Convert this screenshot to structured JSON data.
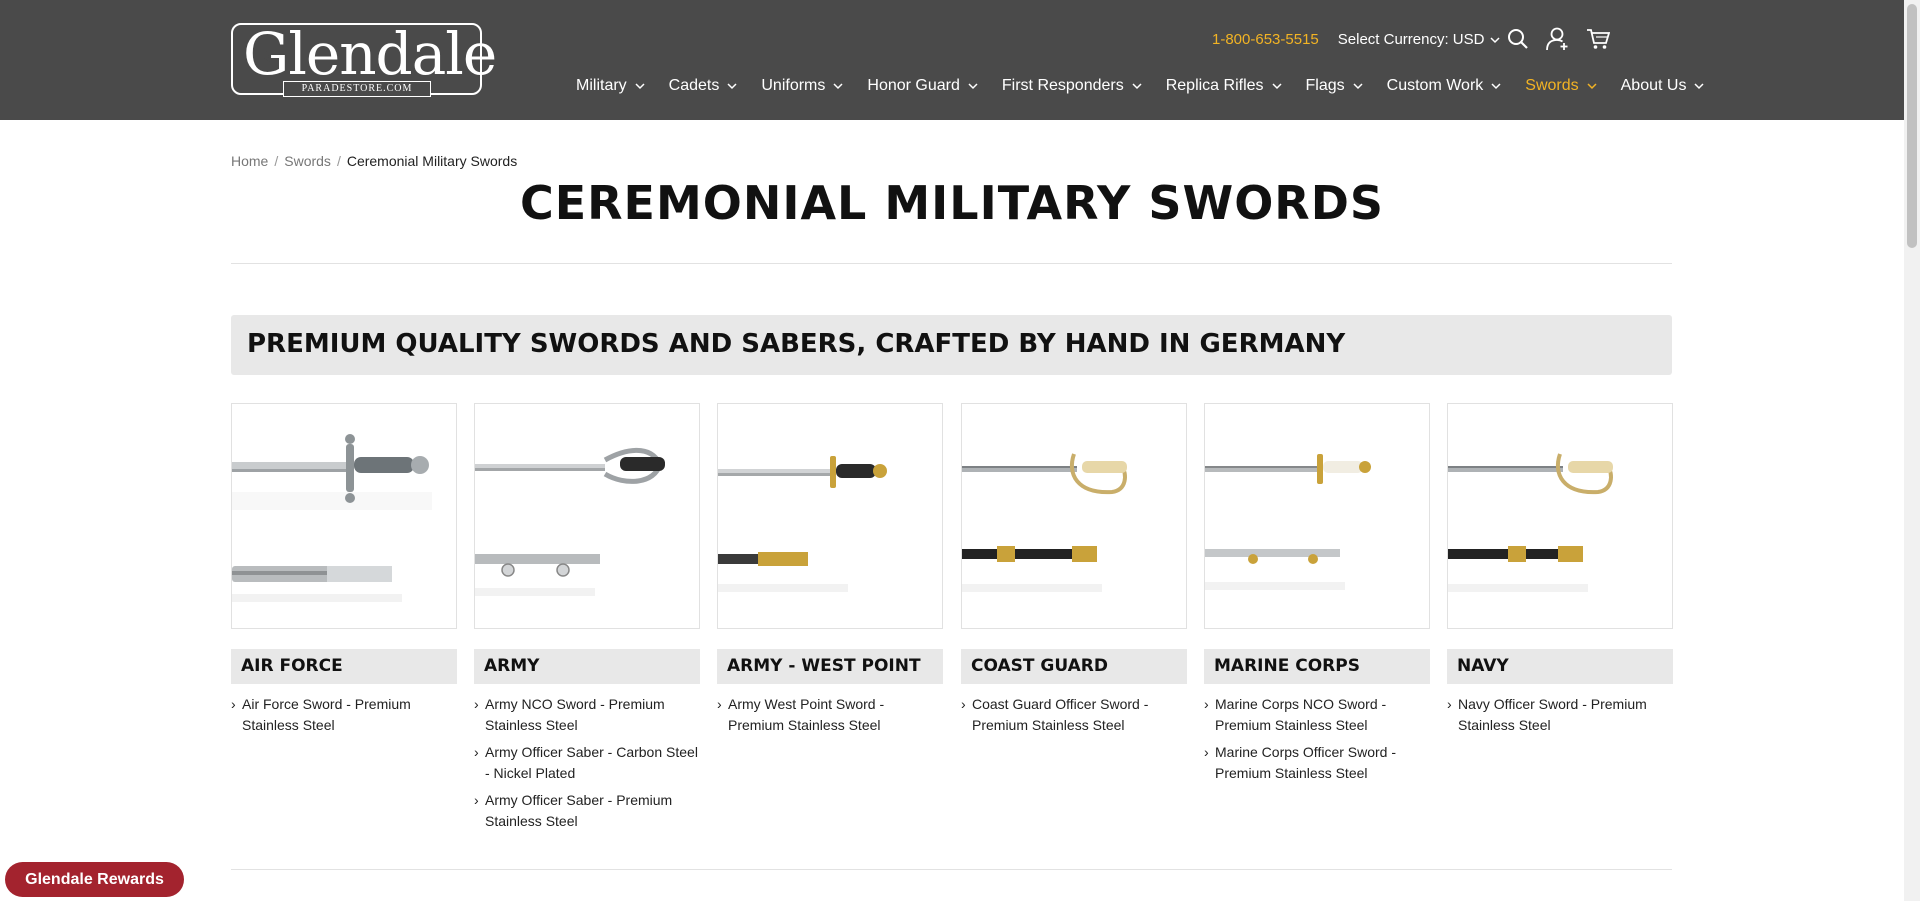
{
  "header": {
    "logo": {
      "word": "Glendale",
      "sub": "PARADESTORE.COM"
    },
    "phone": "1-800-653-5515",
    "currency_label": "Select Currency: USD",
    "icons": [
      "search-icon",
      "account-icon",
      "cart-icon"
    ],
    "nav": [
      {
        "label": "Military"
      },
      {
        "label": "Cadets"
      },
      {
        "label": "Uniforms"
      },
      {
        "label": "Honor Guard"
      },
      {
        "label": "First Responders"
      },
      {
        "label": "Replica Rifles"
      },
      {
        "label": "Flags"
      },
      {
        "label": "Custom Work"
      },
      {
        "label": "Swords",
        "active": true
      },
      {
        "label": "About Us"
      }
    ]
  },
  "breadcrumb": [
    "Home",
    "Swords",
    "Ceremonial Military Swords"
  ],
  "page": {
    "title": "CEREMONIAL MILITARY SWORDS",
    "banner": "PREMIUM QUALITY SWORDS AND SABERS, CRAFTED BY HAND IN GERMANY"
  },
  "categories": [
    {
      "name": "AIR FORCE",
      "links": [
        "Air Force Sword - Premium Stainless Steel"
      ]
    },
    {
      "name": "ARMY",
      "links": [
        "Army NCO Sword - Premium Stainless Steel",
        "Army Officer Saber - Carbon Steel - Nickel Plated",
        "Army Officer Saber - Premium Stainless Steel"
      ]
    },
    {
      "name": "ARMY - WEST POINT",
      "links": [
        "Army West Point Sword - Premium Stainless Steel"
      ]
    },
    {
      "name": "COAST GUARD",
      "links": [
        "Coast Guard Officer Sword - Premium Stainless Steel"
      ]
    },
    {
      "name": "MARINE CORPS",
      "links": [
        "Marine Corps NCO Sword - Premium Stainless Steel",
        "Marine Corps Officer Sword - Premium Stainless Steel"
      ]
    },
    {
      "name": "NAVY",
      "links": [
        "Navy Officer Sword - Premium Stainless Steel"
      ]
    }
  ],
  "rewards_label": "Glendale Rewards",
  "colors": {
    "header_bg": "#4a4a4a",
    "accent": "#f2b324",
    "rewards": "#a3232e"
  }
}
